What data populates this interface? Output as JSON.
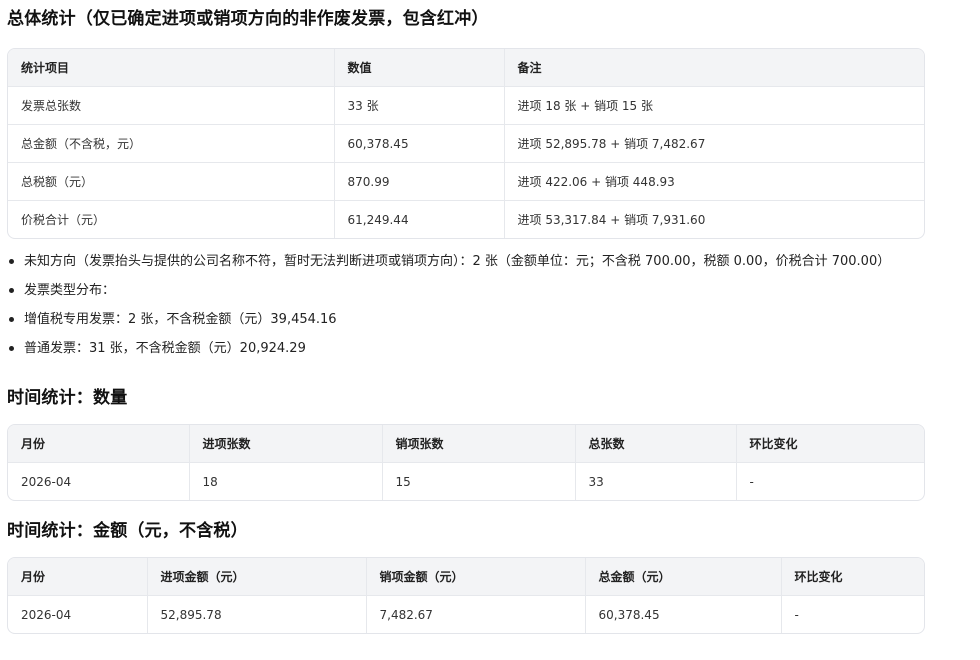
{
  "overall": {
    "title": "总体统计（仅已确定进项或销项方向的非作废发票，包含红冲）",
    "headers": [
      "统计项目",
      "数值",
      "备注"
    ],
    "rows": [
      [
        "发票总张数",
        "33 张",
        "进项 18 张 + 销项 15 张"
      ],
      [
        "总金额（不含税，元）",
        "60,378.45",
        "进项 52,895.78 + 销项 7,482.67"
      ],
      [
        "总税额（元）",
        "870.99",
        "进项 422.06 + 销项 448.93"
      ],
      [
        "价税合计（元）",
        "61,249.44",
        "进项 53,317.84 + 销项 7,931.60"
      ]
    ]
  },
  "notes": [
    "未知方向（发票抬头与提供的公司名称不符，暂时无法判断进项或销项方向）：2 张（金额单位：元；不含税 700.00，税额 0.00，价税合计 700.00）",
    "发票类型分布：",
    "增值税专用发票：2 张，不含税金额（元）39,454.16",
    "普通发票：31 张，不含税金额（元）20,924.29"
  ],
  "count_stats": {
    "title": "时间统计：数量",
    "headers": [
      "月份",
      "进项张数",
      "销项张数",
      "总张数",
      "环比变化"
    ],
    "rows": [
      [
        "2026-04",
        "18",
        "15",
        "33",
        "-"
      ]
    ]
  },
  "amount_stats": {
    "title": "时间统计：金额（元，不含税）",
    "headers": [
      "月份",
      "进项金额（元）",
      "销项金额（元）",
      "总金额（元）",
      "环比变化"
    ],
    "rows": [
      [
        "2026-04",
        "52,895.78",
        "7,482.67",
        "60,378.45",
        "-"
      ]
    ]
  }
}
